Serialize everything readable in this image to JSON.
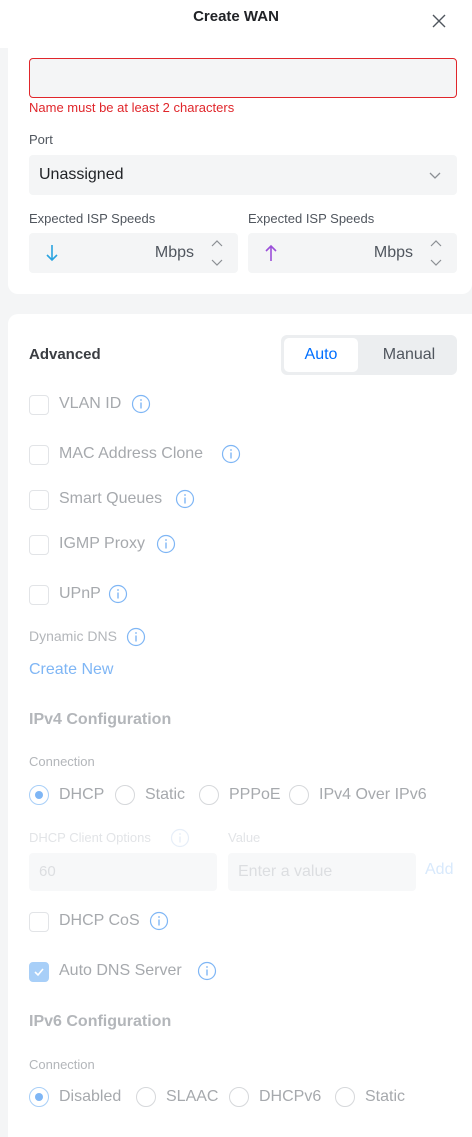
{
  "header": {
    "title": "Create WAN"
  },
  "name_field": {
    "value": "",
    "error": "Name must be at least 2 characters"
  },
  "port": {
    "label": "Port",
    "value": "Unassigned"
  },
  "speeds": {
    "download": {
      "label": "Expected ISP Speeds",
      "unit": "Mbps",
      "value": ""
    },
    "upload": {
      "label": "Expected ISP Speeds",
      "unit": "Mbps",
      "value": ""
    }
  },
  "advanced": {
    "title": "Advanced",
    "mode_options": [
      "Auto",
      "Manual"
    ],
    "selected_mode": "Auto"
  },
  "options": {
    "vlan_id": "VLAN ID",
    "mac_clone": "MAC Address Clone",
    "smart_queues": "Smart Queues",
    "igmp_proxy": "IGMP Proxy",
    "upnp": "UPnP"
  },
  "dynamic_dns": {
    "label": "Dynamic DNS",
    "create_new": "Create New"
  },
  "ipv4": {
    "title": "IPv4 Configuration",
    "connection_label": "Connection",
    "connection_options": [
      "DHCP",
      "Static",
      "PPPoE",
      "IPv4 Over IPv6"
    ],
    "selected": "DHCP",
    "dhcp_client_label": "DHCP Client Options",
    "value_label": "Value",
    "client_option_value": "60",
    "value_placeholder": "Enter a value",
    "add_label": "Add",
    "dhcp_cos": "DHCP CoS",
    "auto_dns": "Auto DNS Server",
    "auto_dns_checked": true
  },
  "ipv6": {
    "title": "IPv6 Configuration",
    "connection_label": "Connection",
    "connection_options": [
      "Disabled",
      "SLAAC",
      "DHCPv6",
      "Static"
    ],
    "selected": "Disabled"
  },
  "colors": {
    "accent": "#006fff",
    "error": "#e0262b",
    "download_arrow": "#29a3e0",
    "upload_arrow": "#9b4fd9"
  }
}
